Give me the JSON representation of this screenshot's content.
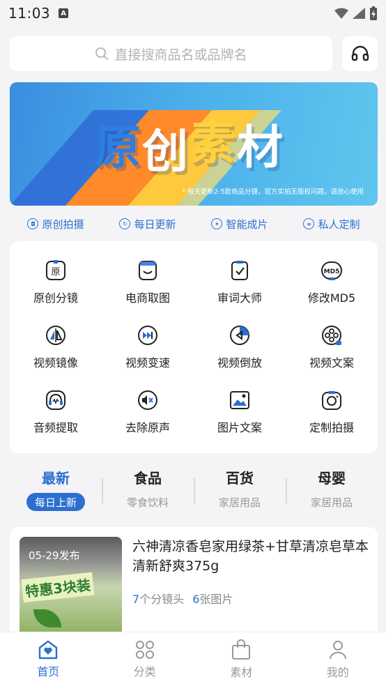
{
  "status_bar": {
    "time": "11:03",
    "notif_glyph": "A"
  },
  "search": {
    "placeholder": "直接搜商品名或品牌名"
  },
  "banner": {
    "chars": [
      "原",
      "创",
      "素",
      "材"
    ],
    "note": "* 每天更新2-5款商品分镜，官方实拍无版权问题，请放心使用"
  },
  "features": [
    {
      "label": "原创拍摄",
      "icon": "camera-icon"
    },
    {
      "label": "每日更新",
      "icon": "refresh-icon"
    },
    {
      "label": "智能成片",
      "icon": "magic-icon"
    },
    {
      "label": "私人定制",
      "icon": "custom-icon"
    }
  ],
  "tools": [
    {
      "label": "原创分镜",
      "icon": "storyboard-icon"
    },
    {
      "label": "电商取图",
      "icon": "bag-icon"
    },
    {
      "label": "审词大师",
      "icon": "checklist-icon"
    },
    {
      "label": "修改MD5",
      "icon": "md5-icon"
    },
    {
      "label": "视频镜像",
      "icon": "mirror-icon"
    },
    {
      "label": "视频变速",
      "icon": "fast-forward-icon"
    },
    {
      "label": "视频倒放",
      "icon": "rewind-icon"
    },
    {
      "label": "视频文案",
      "icon": "film-reel-icon"
    },
    {
      "label": "音频提取",
      "icon": "audio-icon"
    },
    {
      "label": "去除原声",
      "icon": "mute-icon"
    },
    {
      "label": "图片文案",
      "icon": "image-icon"
    },
    {
      "label": "定制拍摄",
      "icon": "camera-lens-icon"
    }
  ],
  "categories": [
    {
      "title": "最新",
      "sub": "每日上新",
      "active": true
    },
    {
      "title": "食品",
      "sub": "零食饮料",
      "active": false
    },
    {
      "title": "百货",
      "sub": "家居用品",
      "active": false
    },
    {
      "title": "母婴",
      "sub": "家居用品",
      "active": false
    }
  ],
  "product": {
    "date": "05-29发布",
    "pack_text": "特惠3块装",
    "title": "六神清凉香皂家用绿茶+甘草清凉皂草本清新舒爽375g",
    "shots_count": "7",
    "shots_label": "个分镜头",
    "images_count": "6",
    "images_label": "张图片"
  },
  "tabbar": [
    {
      "label": "首页",
      "icon": "home-icon",
      "active": true
    },
    {
      "label": "分类",
      "icon": "grid-icon",
      "active": false
    },
    {
      "label": "素材",
      "icon": "bag-icon",
      "active": false
    },
    {
      "label": "我的",
      "icon": "user-icon",
      "active": false
    }
  ],
  "colors": {
    "accent": "#2b6fd0",
    "banner_blue": "#3b8de0",
    "banner_orange": "#ff9d2f",
    "banner_yellow": "#ffd64a",
    "text_muted": "#999999"
  }
}
